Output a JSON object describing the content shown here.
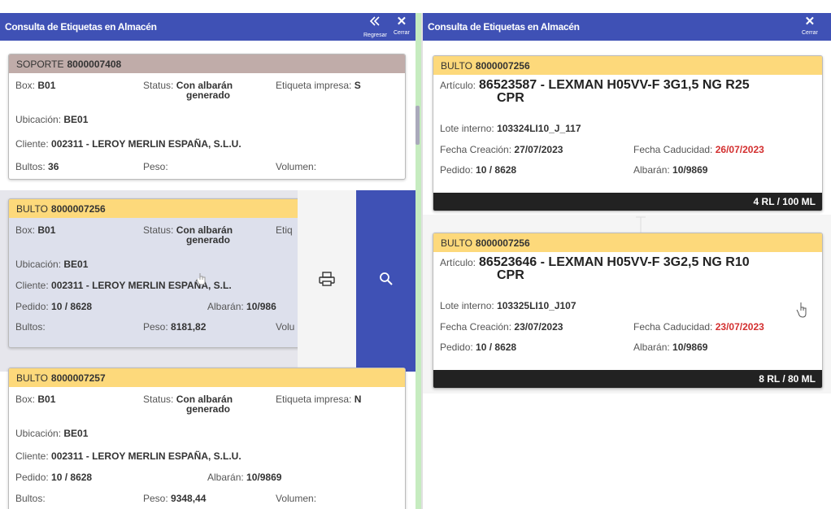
{
  "left_panel": {
    "title": "Consulta de Etiquetas en Almacén",
    "back_label": "Regresar",
    "close_label": "Cerrar",
    "cards": [
      {
        "kind": "SOPORTE",
        "code": "8000007408",
        "box_label": "Box:",
        "box": "B01",
        "status_label": "Status:",
        "status_1": "Con albarán",
        "status_2": "generado",
        "label_printed_label": "Etiqueta impresa:",
        "label_printed": "S",
        "location_label": "Ubicación:",
        "location": "BE01",
        "client_label": "Cliente:",
        "client": "002311 - LEROY MERLIN ESPAÑA, S.L.U.",
        "packages_label": "Bultos:",
        "packages": "36",
        "weight_label": "Peso:",
        "weight": "",
        "volume_label": "Volumen:",
        "volume": ""
      },
      {
        "kind": "BULTO",
        "code": "8000007256",
        "box_label": "Box:",
        "box": "B01",
        "status_label": "Status:",
        "status_1": "Con albarán",
        "status_2": "generado",
        "label_printed_label": "Etiq",
        "location_label": "Ubicación:",
        "location": "BE01",
        "client_label": "Cliente:",
        "client": "002311 - LEROY MERLIN ESPAÑA, S.L.",
        "order_label": "Pedido:",
        "order": "10 / 8628",
        "delivery_label": "Albarán:",
        "delivery": "10/986",
        "packages_label": "Bultos:",
        "packages": "",
        "weight_label": "Peso:",
        "weight": "8181,82",
        "volume_label": "Volu"
      },
      {
        "kind": "BULTO",
        "code": "8000007257",
        "box_label": "Box:",
        "box": "B01",
        "status_label": "Status:",
        "status_1": "Con albarán",
        "status_2": "generado",
        "label_printed_label": "Etiqueta impresa:",
        "label_printed": "N",
        "location_label": "Ubicación:",
        "location": "BE01",
        "client_label": "Cliente:",
        "client": "002311 - LEROY MERLIN ESPAÑA, S.L.U.",
        "order_label": "Pedido:",
        "order": "10 / 8628",
        "delivery_label": "Albarán:",
        "delivery": "10/9869",
        "packages_label": "Bultos:",
        "packages": "",
        "weight_label": "Peso:",
        "weight": "9348,44",
        "volume_label": "Volumen:",
        "volume": ""
      }
    ]
  },
  "right_panel": {
    "title": "Consulta de Etiquetas en Almacén",
    "close_label": "Cerrar",
    "cards": [
      {
        "kind": "BULTO",
        "code": "8000007256",
        "article_label": "Artículo:",
        "article_1": "86523587 - LEXMAN H05VV-F 3G1,5 NG R25",
        "article_2": "CPR",
        "lot_label": "Lote interno:",
        "lot": "103324LI10_J_117",
        "created_label": "Fecha Creación:",
        "created": "27/07/2023",
        "expiry_label": "Fecha Caducidad:",
        "expiry": "26/07/2023",
        "order_label": "Pedido:",
        "order": "10 / 8628",
        "delivery_label": "Albarán:",
        "delivery": "10/9869",
        "quantity": "4 RL / 100 ML"
      },
      {
        "kind": "BULTO",
        "code": "8000007256",
        "article_label": "Artículo:",
        "article_1": "86523646 - LEXMAN H05VV-F 3G2,5 NG R10",
        "article_2": "CPR",
        "lot_label": "Lote interno:",
        "lot": "103325LI10_J107",
        "created_label": "Fecha Creación:",
        "created": "23/07/2023",
        "expiry_label": "Fecha Caducidad:",
        "expiry": "23/07/2023",
        "order_label": "Pedido:",
        "order": "10 / 8628",
        "delivery_label": "Albarán:",
        "delivery": "10/9869",
        "quantity": "8 RL / 80 ML"
      }
    ]
  },
  "colors": {
    "primary": "#3f51b5",
    "header_yellow": "#fdd97b",
    "header_brown": "#c0aca9",
    "expiry_red": "#d32f2f",
    "footer_dark": "#222222"
  },
  "icons": [
    "back-icon",
    "close-icon",
    "print-icon",
    "search-icon",
    "cursor-hand-icon"
  ]
}
